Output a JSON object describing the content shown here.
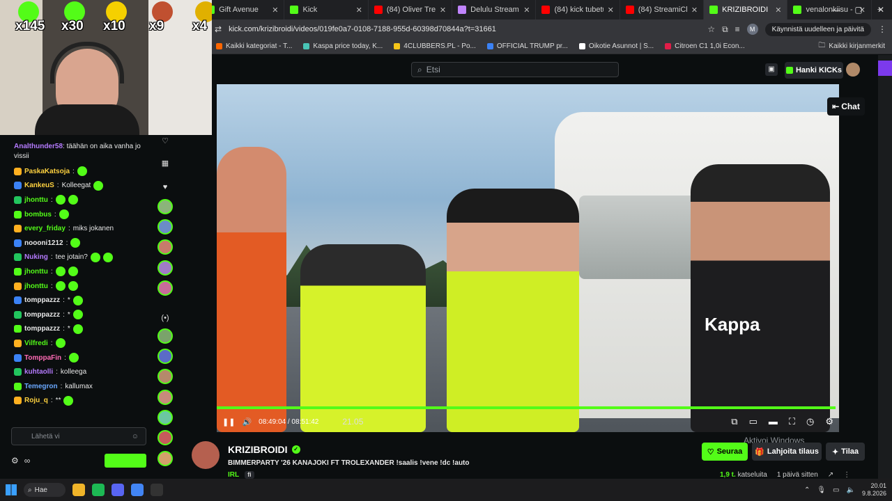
{
  "browser": {
    "tabs": [
      {
        "title": "Gift Avenue",
        "color": "#53fc18"
      },
      {
        "title": "Kick",
        "color": "#53fc18"
      },
      {
        "title": "(84) Oliver Tree &",
        "color": "#ff0000"
      },
      {
        "title": "Delulu Stream",
        "color": "#c084fc"
      },
      {
        "title": "(84) kick tubetus",
        "color": "#ff0000"
      },
      {
        "title": "(84) StreamiClip",
        "color": "#ff0000"
      },
      {
        "title": "KRIZIBROIDI",
        "color": "#53fc18",
        "active": true
      },
      {
        "title": "venalonkiisu - W",
        "color": "#53fc18"
      }
    ],
    "url": "kick.com/krizibroidi/videos/019fe0a7-0108-7188-955d-60398d70844a?t=31661",
    "restart_label": "Käynnistä uudelleen ja päivitä",
    "profile_initial": "M",
    "bookmarks": [
      {
        "label": "Kaikki kategoriat - T...",
        "color": "#ff6600"
      },
      {
        "label": "Kaspa price today, K...",
        "color": "#49c5b6"
      },
      {
        "label": "4CLUBBERS.PL - Po...",
        "color": "#f5c518"
      },
      {
        "label": "OFFICIAL TRUMP pr...",
        "color": "#3b82f6"
      },
      {
        "label": "Oikotie Asunnot | S...",
        "color": "#ffffff"
      },
      {
        "label": "Citroen C1 1,0i Econ...",
        "color": "#e11d48"
      }
    ],
    "bookmarks_all": "Kaikki kirjanmerkit"
  },
  "kick_header": {
    "search_placeholder": "Etsi",
    "get_kicks_label": "Hanki KICKs",
    "chat_toggle_label": "Chat"
  },
  "webcam": {
    "multipliers": [
      {
        "label": "x145",
        "color": "#53fc18"
      },
      {
        "label": "x30",
        "color": "#53fc18"
      },
      {
        "label": "x10",
        "color": "#f5d000"
      },
      {
        "label": "x9",
        "color": "#c05030"
      },
      {
        "label": "x4",
        "color": "#e0b000"
      }
    ]
  },
  "video": {
    "jersey_text": "Kappa",
    "current_time": "08:49:04",
    "duration": "08:51:42",
    "overlay_time": "21.05",
    "progress_fraction": 0.998
  },
  "channel": {
    "name": "KRIZIBROIDI",
    "title": "BIMMERPARTY '26 KANAJOKI FT TROLEXANDER !saalis !vene !dc !auto",
    "category": "IRL",
    "language": "fi",
    "follow_label": "Seuraa",
    "gift_label": "Lahjoita tilaus",
    "subscribe_label": "Tilaa",
    "views_count": "1,9 t.",
    "views_label": "katseluita",
    "age": "1 päivä sitten",
    "activation_watermark": "Aktivoi Windows"
  },
  "chat": {
    "messages": [
      {
        "user": "Analthunder58",
        "color": "#b57bff",
        "text": "täähän on aika vanha jo vissii",
        "two_line": true
      },
      {
        "user": "PaskaKatsoja",
        "color": "#ffd23f",
        "text": "",
        "emotes": 1
      },
      {
        "user": "KankeuS",
        "color": "#ffd23f",
        "text": "Kolleegat",
        "emotes": 1
      },
      {
        "user": "jhonttu",
        "color": "#53fc18",
        "text": "",
        "emotes": 2
      },
      {
        "user": "bombus",
        "color": "#53fc18",
        "text": "",
        "emotes": 1
      },
      {
        "user": "every_friday",
        "color": "#53fc18",
        "text": "miks jokanen",
        "emotes": 0
      },
      {
        "user": "noooni1212",
        "color": "#e8e8e8",
        "text": "",
        "emotes": 1
      },
      {
        "user": "Nuking",
        "color": "#b57bff",
        "text": "tee jotain?",
        "emotes": 2
      },
      {
        "user": "jhonttu",
        "color": "#53fc18",
        "text": "",
        "emotes": 2
      },
      {
        "user": "jhonttu",
        "color": "#53fc18",
        "text": "",
        "emotes": 2
      },
      {
        "user": "tomppazzz",
        "color": "#e8e8e8",
        "text": "*",
        "emotes": 1
      },
      {
        "user": "tomppazzz",
        "color": "#e8e8e8",
        "text": "*",
        "emotes": 1
      },
      {
        "user": "tomppazzz",
        "color": "#e8e8e8",
        "text": "*",
        "emotes": 1
      },
      {
        "user": "Vilfredi",
        "color": "#53fc18",
        "text": "",
        "emotes": 1
      },
      {
        "user": "TomppaFin",
        "color": "#ff6bb5",
        "text": "",
        "emotes": 1
      },
      {
        "user": "kuhtaolli",
        "color": "#b57bff",
        "text": "kolleega",
        "emotes": 0
      },
      {
        "user": "Temegron",
        "color": "#6aa8ff",
        "text": "kallumax",
        "emotes": 0
      },
      {
        "user": "Roju_q",
        "color": "#ffd23f",
        "text": "**",
        "emotes": 1
      }
    ],
    "input_placeholder": "Lähetä vi"
  },
  "taskbar": {
    "search_label": "Hae",
    "time": "20.01",
    "date": "9.8.2026"
  }
}
